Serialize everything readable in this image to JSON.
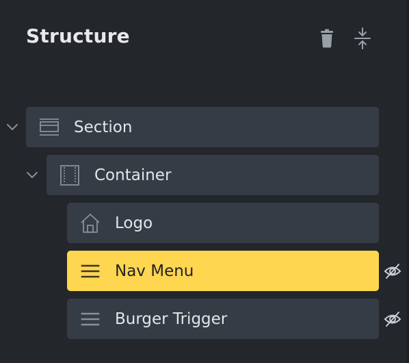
{
  "panel": {
    "title": "Structure",
    "header_icons": [
      "trash-icon",
      "collapse-vertical-icon"
    ]
  },
  "tree": [
    {
      "label": "Section",
      "icon": "section-icon",
      "depth": 0,
      "expanded": true,
      "active": false,
      "hidden": false
    },
    {
      "label": "Container",
      "icon": "container-icon",
      "depth": 1,
      "expanded": true,
      "active": false,
      "hidden": false
    },
    {
      "label": "Logo",
      "icon": "home-icon",
      "depth": 2,
      "active": false,
      "hidden": false
    },
    {
      "label": "Nav Menu",
      "icon": "menu-lines-icon",
      "depth": 2,
      "active": true,
      "hidden": true
    },
    {
      "label": "Burger Trigger",
      "icon": "menu-lines-icon",
      "depth": 2,
      "active": false,
      "hidden": true
    }
  ],
  "colors": {
    "background": "#23272c",
    "row": "#363c45",
    "active_row": "#ffd64f",
    "text": "#e3e6ea",
    "icon": "#8a9098"
  }
}
